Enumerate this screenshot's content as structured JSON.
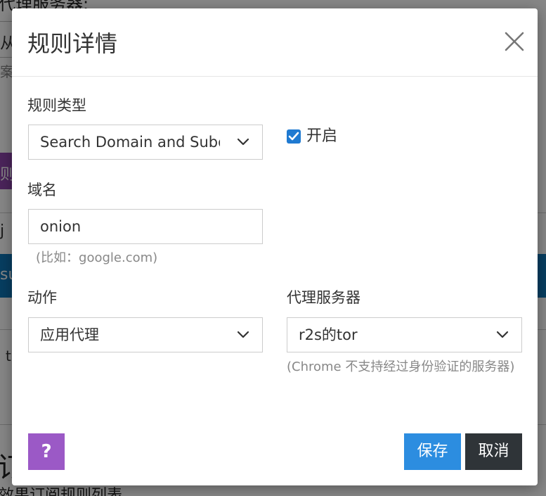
{
  "background": {
    "heading_fragment": "代理服务器:",
    "input_fragment": "从",
    "hint_fragment": "案",
    "purple_fragment": "则",
    "tab_fragment": "j",
    "blue_fragment": "su",
    "row_fragment": "t",
    "big_fragment": "订",
    "bottom_fragment": "效果订阅规则列表"
  },
  "modal": {
    "title": "规则详情",
    "close_icon": "close-icon",
    "rule_type": {
      "label": "规则类型",
      "selected": "Search Domain and Subdomains"
    },
    "enabled": {
      "label": "开启",
      "checked": true
    },
    "domain": {
      "label": "域名",
      "value": "onion",
      "hint": "(比如：google.com)"
    },
    "action": {
      "label": "动作",
      "selected": "应用代理"
    },
    "proxy_server": {
      "label": "代理服务器",
      "selected": "r2s的tor",
      "note": "(Chrome 不支持经过身份验证的服务器)"
    },
    "buttons": {
      "help": "?",
      "save": "保存",
      "cancel": "取消"
    }
  },
  "colors": {
    "primary": "#2c8de0",
    "dark": "#2f3438",
    "purple": "#9b59c6",
    "checkbox": "#1f7ad1"
  }
}
